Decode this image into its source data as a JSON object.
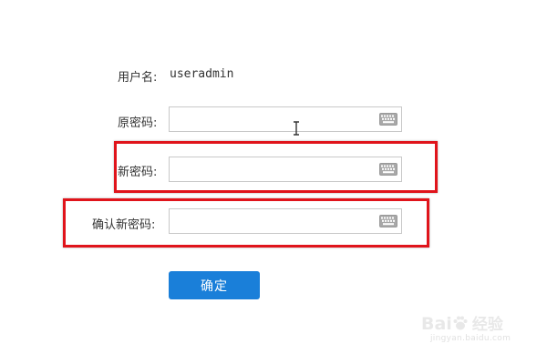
{
  "form": {
    "username_label": "用户名:",
    "username_value": "useradmin",
    "old_password_label": "原密码:",
    "new_password_label": "新密码:",
    "confirm_password_label": "确认新密码:",
    "submit_label": "确定"
  },
  "icons": {
    "keyboard": "keyboard-icon",
    "text_cursor": "text-cursor-icon"
  },
  "watermark": {
    "logo_text": "Bai",
    "logo_suffix": "经验",
    "url": "jingyan.baidu.com"
  },
  "colors": {
    "highlight": "#e0141b",
    "button": "#1a7fd9",
    "field_border": "#c8c8c8"
  }
}
